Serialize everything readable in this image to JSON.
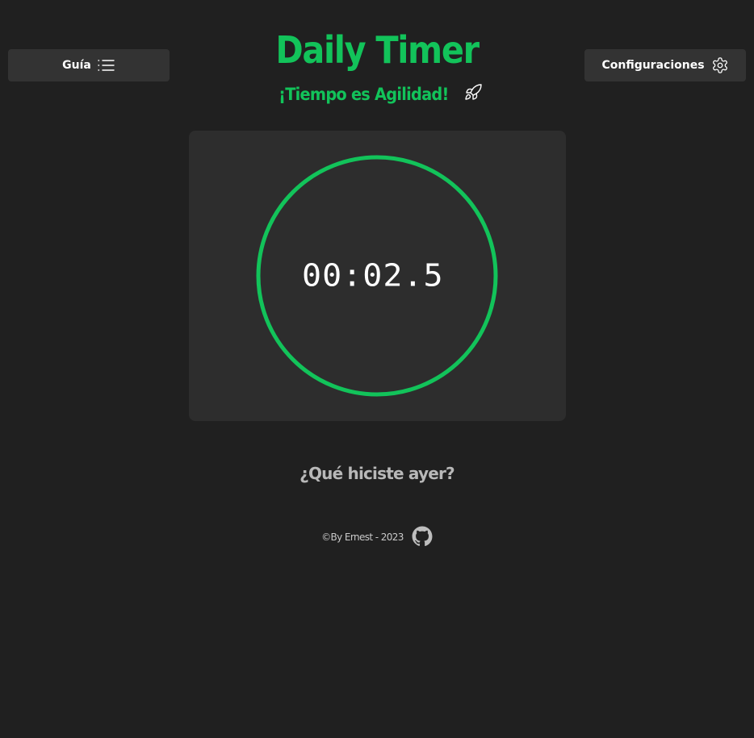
{
  "header": {
    "title": "Daily Timer",
    "subtitle": "¡Tiempo es Agilidad!",
    "subtitle_icon": "rocket-icon"
  },
  "nav": {
    "guide_label": "Guía",
    "guide_icon": "list-icon",
    "settings_label": "Configuraciones",
    "settings_icon": "gear-icon"
  },
  "timer": {
    "display": "00:02.58",
    "progress": 1.0,
    "ring_color": "#12c35a"
  },
  "prompt": {
    "question": "¿Qué hiciste ayer?"
  },
  "footer": {
    "credit": "©By Ernest - 2023",
    "github_icon": "github-icon"
  },
  "colors": {
    "background": "#202020",
    "card": "#2d2d2d",
    "button": "#333333",
    "accent": "#12c35a"
  }
}
